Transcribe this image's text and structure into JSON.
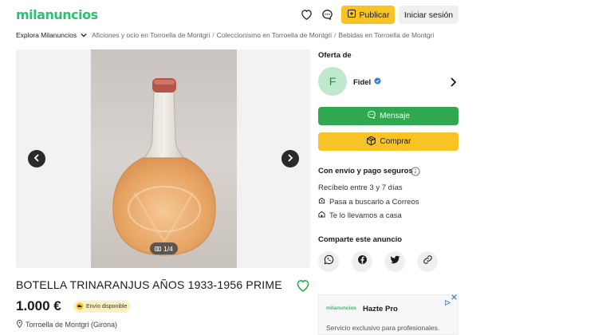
{
  "header": {
    "logo": "milanuncios",
    "publish_label": "Publicar",
    "login_label": "Iniciar sesión"
  },
  "breadcrumb": {
    "explore": "Explora Milanuncios",
    "items": [
      "Aficiones y ocio en Torroella de Montgri",
      "Coleccionismo en Torroella de Montgri",
      "Bebidas en Torroella de Montgri"
    ],
    "separator": "/"
  },
  "gallery": {
    "counter": "1/4"
  },
  "listing": {
    "title": "BOTELLA TRINARANJUS AÑOS 1933-1956 PRIME",
    "price": "1.000 €",
    "shipping_badge": "Envío disponible",
    "location": "Torroella de Montgri (Girona)"
  },
  "seller": {
    "section_label": "Oferta de",
    "initial": "F",
    "name": "Fidel"
  },
  "actions": {
    "message_label": "Mensaje",
    "buy_label": "Comprar"
  },
  "shipping": {
    "heading": "Con envío y pago seguros",
    "delivery": "Recíbelo entre 3 y 7 días",
    "option_pickup": "Pasa a buscarlo a Correos",
    "option_home": "Te lo llevamos a casa"
  },
  "share": {
    "heading": "Comparte este anuncio",
    "networks": [
      "whatsapp",
      "facebook",
      "twitter",
      "link"
    ]
  },
  "ad": {
    "logo": "milanuncios",
    "title": "Hazte Pro",
    "text": "Servicio exclusivo para profesionales."
  },
  "colors": {
    "brand_green": "#2fbf71",
    "message_green": "#2fa84f",
    "accent_yellow": "#f7c325"
  }
}
